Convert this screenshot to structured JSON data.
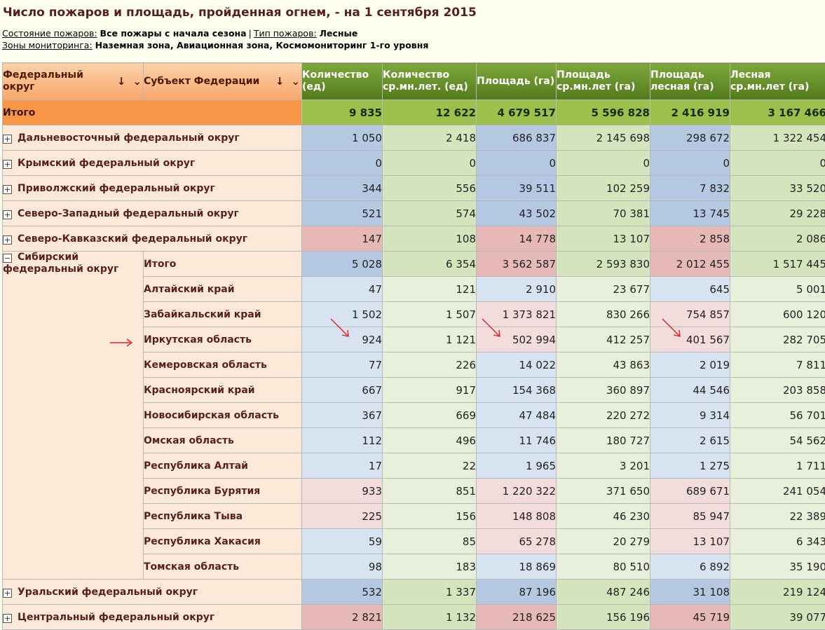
{
  "title": "Число пожаров и площадь, пройденная огнем, - на 1 сентября 2015",
  "filters": {
    "state_label": "Состояние пожаров:",
    "state_value": "Все пожары с начала сезона",
    "separator": "|",
    "type_label": "Тип пожаров:",
    "type_value": "Лесные",
    "zones_label": "Зоны мониторинга:",
    "zones_value": "Наземная зона, Авиационная зона, Космомониторинг 1-го уровня"
  },
  "columns": {
    "dim1": "Федеральный округ",
    "dim2": "Субъект Федерации",
    "sort_glyph": "↓",
    "menu_glyph": "⌄",
    "m1": "Количество (ед)",
    "m2": "Количество ср.мн.лет. (ед)",
    "m3": "Площадь (га)",
    "m4": "Площадь ср.мн.лет (га)",
    "m5": "Площадь лесная (га)",
    "m6": "Лесная ср.мн.лет (га)"
  },
  "total": {
    "label": "Итого",
    "values": [
      "9 835",
      "12 622",
      "4 679 517",
      "5 596 828",
      "2 416 919",
      "3 167 466"
    ]
  },
  "expand_glyph": "+",
  "collapse_glyph": "−",
  "regions_top": [
    {
      "name": "Дальневосточный федеральный округ",
      "values": [
        "1 050",
        "2 418",
        "686 837",
        "2 145 698",
        "298 672",
        "1 322 454"
      ],
      "shades": [
        "cb",
        "cg",
        "cb",
        "cg",
        "cb",
        "cg"
      ]
    },
    {
      "name": "Крымский федеральный округ",
      "values": [
        "0",
        "0",
        "0",
        "0",
        "0",
        "0"
      ],
      "shades": [
        "cb",
        "cg",
        "cb",
        "cg",
        "cb",
        "cg"
      ]
    },
    {
      "name": "Приволжский федеральный округ",
      "values": [
        "344",
        "556",
        "39 511",
        "102 259",
        "7 832",
        "33 520"
      ],
      "shades": [
        "cb",
        "cg",
        "cb",
        "cg",
        "cb",
        "cg"
      ]
    },
    {
      "name": "Северо-Западный федеральный округ",
      "values": [
        "521",
        "574",
        "43 502",
        "70 381",
        "13 745",
        "29 228"
      ],
      "shades": [
        "cb",
        "cg",
        "cb",
        "cg",
        "cb",
        "cg"
      ]
    },
    {
      "name": "Северо-Кавказский федеральный округ",
      "values": [
        "147",
        "108",
        "14 778",
        "13 107",
        "2 858",
        "2 086"
      ],
      "shades": [
        "cr",
        "cg",
        "cr",
        "cg",
        "cr",
        "cg"
      ]
    }
  ],
  "siberia": {
    "name": "Сибирский федеральный округ",
    "subtotal": {
      "label": "Итого",
      "values": [
        "5 028",
        "6 354",
        "3 562 587",
        "2 593 830",
        "2 012 455",
        "1 517 445"
      ],
      "shades": [
        "cb",
        "cg",
        "cr",
        "cg",
        "cr",
        "cg"
      ]
    },
    "subjects": [
      {
        "name": "Алтайский край",
        "values": [
          "47",
          "121",
          "2 910",
          "23 677",
          "645",
          "5 001"
        ],
        "shades": [
          "lb",
          "lg",
          "lb",
          "lg",
          "lb",
          "lg"
        ]
      },
      {
        "name": "Забайкальский край",
        "values": [
          "1 502",
          "1 507",
          "1 373 821",
          "830 266",
          "754 857",
          "600 120"
        ],
        "shades": [
          "lb",
          "lg",
          "lr",
          "lg",
          "lr",
          "lg"
        ]
      },
      {
        "name": "Иркутская область",
        "values": [
          "924",
          "1 121",
          "502 994",
          "412 257",
          "401 567",
          "282 705"
        ],
        "shades": [
          "lb",
          "lg",
          "lr",
          "lg",
          "lr",
          "lg"
        ]
      },
      {
        "name": "Кемеровская область",
        "values": [
          "77",
          "226",
          "14 022",
          "43 863",
          "2 019",
          "7 811"
        ],
        "shades": [
          "lb",
          "lg",
          "lb",
          "lg",
          "lb",
          "lg"
        ]
      },
      {
        "name": "Красноярский край",
        "values": [
          "667",
          "917",
          "154 368",
          "360 897",
          "44 546",
          "203 858"
        ],
        "shades": [
          "lb",
          "lg",
          "lb",
          "lg",
          "lb",
          "lg"
        ]
      },
      {
        "name": "Новосибирская область",
        "values": [
          "367",
          "669",
          "47 484",
          "220 272",
          "9 314",
          "56 701"
        ],
        "shades": [
          "lb",
          "lg",
          "lb",
          "lg",
          "lb",
          "lg"
        ]
      },
      {
        "name": "Омская область",
        "values": [
          "112",
          "496",
          "11 746",
          "180 727",
          "2 615",
          "54 562"
        ],
        "shades": [
          "lb",
          "lg",
          "lb",
          "lg",
          "lb",
          "lg"
        ]
      },
      {
        "name": "Республика Алтай",
        "values": [
          "17",
          "22",
          "1 965",
          "3 201",
          "1 275",
          "1 711"
        ],
        "shades": [
          "lb",
          "lg",
          "lb",
          "lg",
          "lb",
          "lg"
        ]
      },
      {
        "name": "Республика Бурятия",
        "values": [
          "933",
          "851",
          "1 220 322",
          "371 650",
          "689 671",
          "241 054"
        ],
        "shades": [
          "lr",
          "lg",
          "lr",
          "lg",
          "lr",
          "lg"
        ]
      },
      {
        "name": "Республика Тыва",
        "values": [
          "225",
          "156",
          "148 808",
          "46 230",
          "85 947",
          "22 389"
        ],
        "shades": [
          "lr",
          "lg",
          "lr",
          "lg",
          "lr",
          "lg"
        ]
      },
      {
        "name": "Республика Хакасия",
        "values": [
          "59",
          "85",
          "65 278",
          "20 279",
          "13 107",
          "6 343"
        ],
        "shades": [
          "lb",
          "lg",
          "lr",
          "lg",
          "lr",
          "lg"
        ]
      },
      {
        "name": "Томская область",
        "values": [
          "98",
          "183",
          "18 869",
          "80 510",
          "6 892",
          "35 190"
        ],
        "shades": [
          "lb",
          "lg",
          "lb",
          "lg",
          "lb",
          "lg"
        ]
      }
    ]
  },
  "regions_bottom": [
    {
      "name": "Уральский федеральный округ",
      "values": [
        "532",
        "1 337",
        "87 196",
        "487 246",
        "31 108",
        "219 124"
      ],
      "shades": [
        "cb",
        "cg",
        "cb",
        "cg",
        "cb",
        "cg"
      ]
    },
    {
      "name": "Центральный федеральный округ",
      "values": [
        "2 821",
        "1 132",
        "218 625",
        "156 196",
        "45 719",
        "39 077"
      ],
      "shades": [
        "cr",
        "cg",
        "cr",
        "cg",
        "cr",
        "cg"
      ]
    }
  ],
  "colors": {
    "header_dim": "#f8a76a",
    "header_measure": "#6a9a2c",
    "total_label": "#f79646",
    "total_values": "#9bc04c",
    "annotation_arrow": "#e02020"
  }
}
